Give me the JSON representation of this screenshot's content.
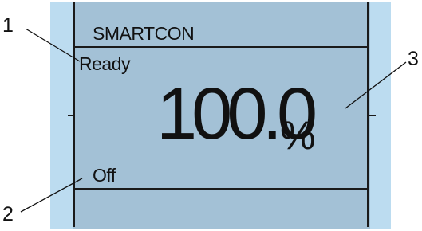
{
  "display": {
    "title": "SMARTCON",
    "status": "Ready",
    "value": "100.0",
    "unit": "%",
    "mode": "Off"
  },
  "callouts": [
    "1",
    "2",
    "3"
  ],
  "colors": {
    "bezel": "#bcdcf0",
    "screen": "#a3c1d6",
    "ink": "#111111"
  }
}
